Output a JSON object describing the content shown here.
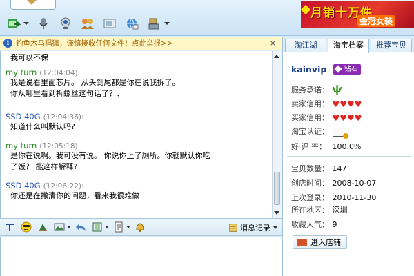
{
  "ad": {
    "line1": "月销十万件",
    "line2": "金冠女装",
    "bg": "#c8102e"
  },
  "toolbar": {
    "icons": [
      "send-file-icon",
      "microphone-icon",
      "webcam-icon",
      "group-icon",
      "screenshot-icon",
      "browser-icon",
      "tools-icon"
    ]
  },
  "notice": {
    "text": "钓鱼木马猖獗，谨慎接收任何文件！点此举报>>",
    "close": "×"
  },
  "messages": [
    {
      "sender": "",
      "time": "",
      "lines": [
        "我可以不保"
      ]
    },
    {
      "sender": "my turn",
      "time": "(12:04:04):",
      "lines": [
        "我是说看里面芯片。  从头到尾都是你在说我拆了。",
        "你从哪里看到拆螺丝这句话了？、"
      ]
    },
    {
      "sender": "SSD 40G",
      "time": "(12:04:36):",
      "lines": [
        "知道什么叫默认吗?"
      ]
    },
    {
      "sender": "my turn",
      "time": "(12:05:18):",
      "lines": [
        "是你在说啊。我可没有说。     你说你上了厕所。你就默认你吃",
        "了饭？   能这样解释?"
      ]
    },
    {
      "sender": "SSD 40G",
      "time": "(12:06:22):",
      "lines": [
        "你还是在撇清你的问题，看来我很难做"
      ]
    }
  ],
  "input_toolbar": {
    "history_label": "消息记录"
  },
  "panel": {
    "tabs": [
      "淘江湖",
      "淘宝档案",
      "推荐宝贝"
    ],
    "active_tab": 1,
    "shop_name": "kainvip",
    "badge": "钻石",
    "service_label": "服务承诺：",
    "seller_credit_label": "卖家信用：",
    "buyer_credit_label": "买家信用：",
    "seller_hearts": 4,
    "buyer_hearts": 4,
    "certification_label": "淘宝认证：",
    "rating_label": "好 评 率：",
    "rating_value": "100.0%",
    "item_count_label": "宝贝数量：",
    "item_count": "147",
    "created_label": "创店时间：",
    "created": "2008-10-07",
    "last_login_label": "上次登录：",
    "last_login": "2010-11-30",
    "region_label": "所在地区：",
    "region": "深圳",
    "popularity_label": "收藏人气：",
    "popularity": "9",
    "enter_shop": "进入店铺"
  },
  "colors": {
    "me": "#2f8a2a",
    "other": "#2a56c4",
    "accent": "#1b3f82"
  }
}
